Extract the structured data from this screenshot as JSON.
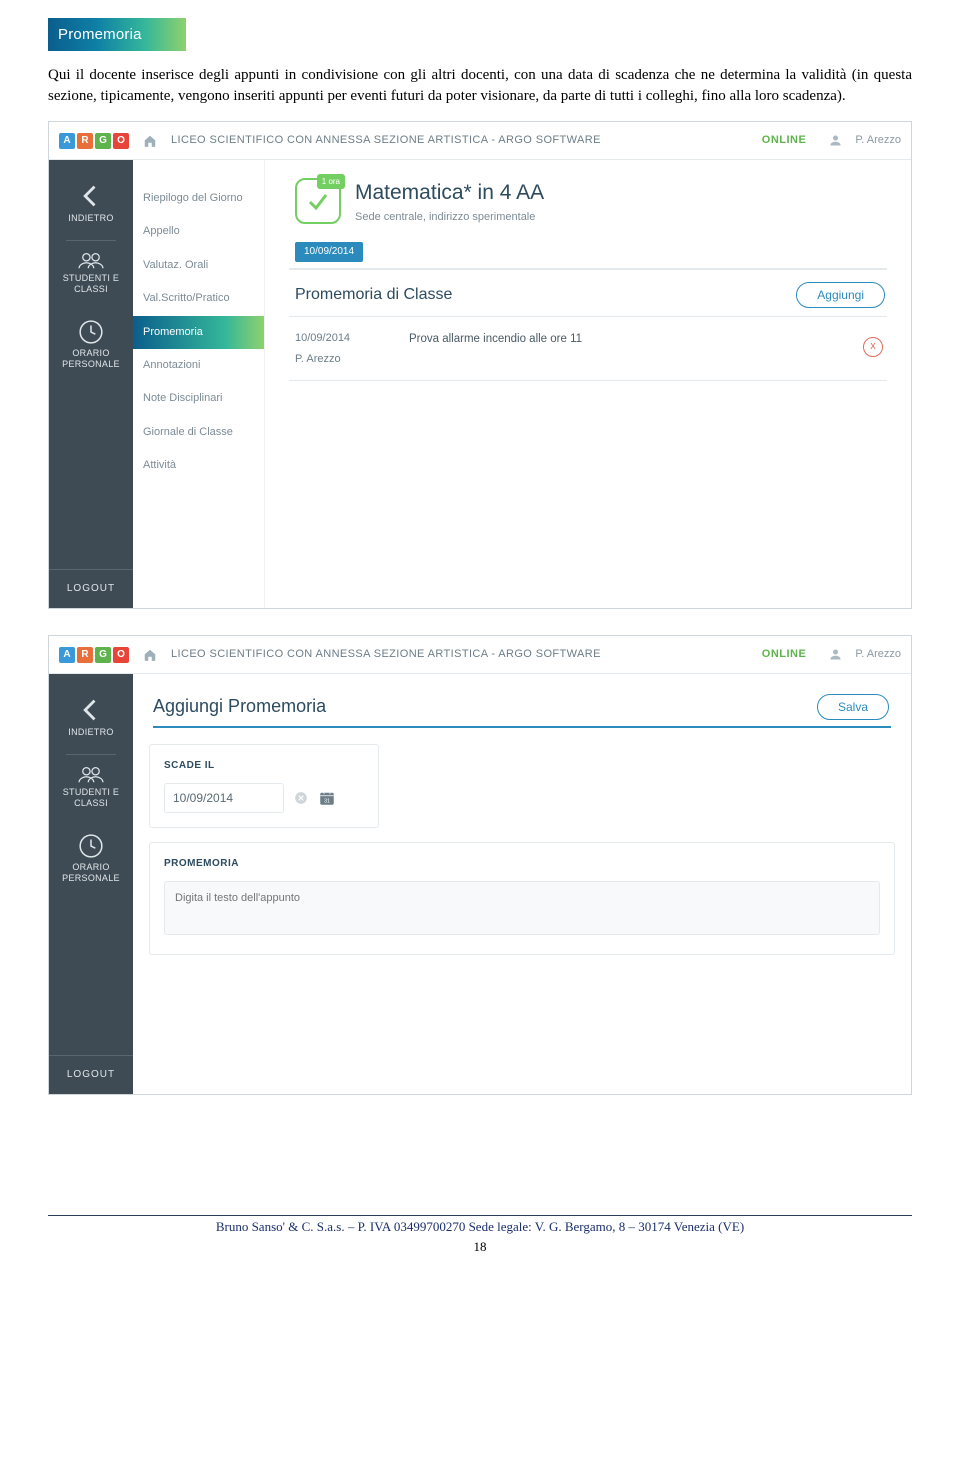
{
  "header_badge": "Promemoria",
  "body_paragraph": "Qui il docente inserisce degli appunti in condivisione con gli altri docenti, con una data di scadenza che ne determina la validità (in questa sezione, tipicamente, vengono inseriti appunti per eventi futuri da poter visionare, da parte di tutti i colleghi, fino alla loro scadenza).",
  "topbar": {
    "logo_letters": [
      "A",
      "R",
      "G",
      "O"
    ],
    "school": "LICEO SCIENTIFICO CON ANNESSA SEZIONE ARTISTICA - ARGO SOFTWARE",
    "status": "ONLINE",
    "user": "P. Arezzo"
  },
  "rail": {
    "indietro": "INDIETRO",
    "studenti": "STUDENTI E CLASSI",
    "orario": "ORARIO PERSONALE",
    "logout": "LOGOUT"
  },
  "subside": {
    "items": [
      "Riepilogo del Giorno",
      "Appello",
      "Valutaz. Orali",
      "Val.Scritto/Pratico",
      "Promemoria",
      "Annotazioni",
      "Note Disciplinari",
      "Giornale di Classe",
      "Attività"
    ],
    "active_index": 4
  },
  "class_header": {
    "ora_badge": "1 ora",
    "title": "Matematica* in 4 AA",
    "subtitle": "Sede centrale, indirizzo sperimentale",
    "date_chip": "10/09/2014"
  },
  "memo_section": {
    "title": "Promemoria di Classe",
    "add_button": "Aggiungi",
    "rows": [
      {
        "date": "10/09/2014",
        "text": "Prova allarme incendio alle ore 11",
        "author": "P. Arezzo"
      }
    ]
  },
  "ss2": {
    "title": "Aggiungi Promemoria",
    "save": "Salva",
    "scade_label": "SCADE IL",
    "scade_value": "10/09/2014",
    "promemoria_label": "PROMEMORIA",
    "placeholder": "Digita il testo dell'appunto"
  },
  "footer": {
    "line": "Bruno Sanso' & C. S.a.s. – P. IVA 03499700270 Sede legale: V. G. Bergamo, 8 – 30174 Venezia (VE)",
    "page_no": "18"
  }
}
